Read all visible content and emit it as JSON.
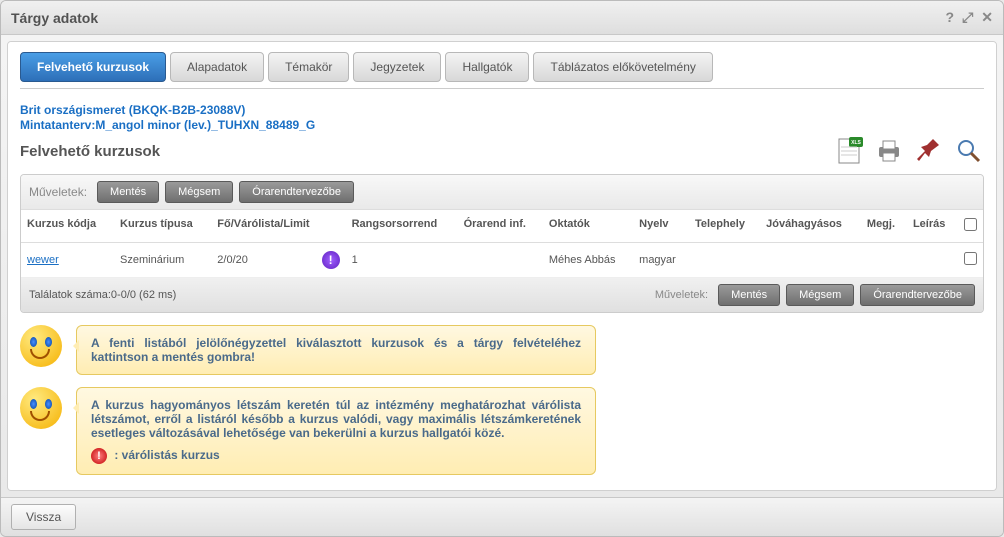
{
  "dialog": {
    "title": "Tárgy adatok"
  },
  "tabs": [
    "Felvehető kurzusok",
    "Alapadatok",
    "Témakör",
    "Jegyzetek",
    "Hallgatók",
    "Táblázatos előkövetelmény"
  ],
  "breadcrumb": {
    "line1": "Brit országismeret (BKQK-B2B-23088V)",
    "line2": "Mintatanterv:M_angol minor (lev.)_TUHXN_88489_G"
  },
  "section_title": "Felvehető kurzusok",
  "ops": {
    "label": "Műveletek:",
    "save": "Mentés",
    "cancel": "Mégsem",
    "planner": "Órarendtervezőbe"
  },
  "table": {
    "headers": {
      "code": "Kurzus kódja",
      "type": "Kurzus típusa",
      "limit": "Fő/Várólista/Limit",
      "rank": "Rangsorsorrend",
      "schedule": "Órarend inf.",
      "teachers": "Oktatók",
      "lang": "Nyelv",
      "site": "Telephely",
      "approval": "Jóváhagyásos",
      "note": "Megj.",
      "desc": "Leírás"
    },
    "rows": [
      {
        "code": "wewer",
        "type": "Szeminárium",
        "limit": "2/0/20",
        "rank": "1",
        "schedule": "",
        "teachers": "Méhes Abbás",
        "lang": "magyar",
        "site": "",
        "approval": "",
        "note": "",
        "desc": ""
      }
    ]
  },
  "results_count": "Találatok száma:0-0/0 (62 ms)",
  "info1": "A fenti listából jelölőnégyzettel kiválasztott kurzusok és a tárgy felvételéhez kattintson a mentés gombra!",
  "info2": "A kurzus hagyományos létszám keretén túl az intézmény meghatározhat várólista létszámot, erről a listáról később a kurzus valódi, vagy maximális létszámkeretének esetleges változásával lehetősége van bekerülni a kurzus hallgatói közé.",
  "legend_waitlist": ": várólistás kurzus",
  "back": "Vissza",
  "icons": {
    "xls": "XLS",
    "print": "print",
    "pin": "pin",
    "search": "search"
  }
}
